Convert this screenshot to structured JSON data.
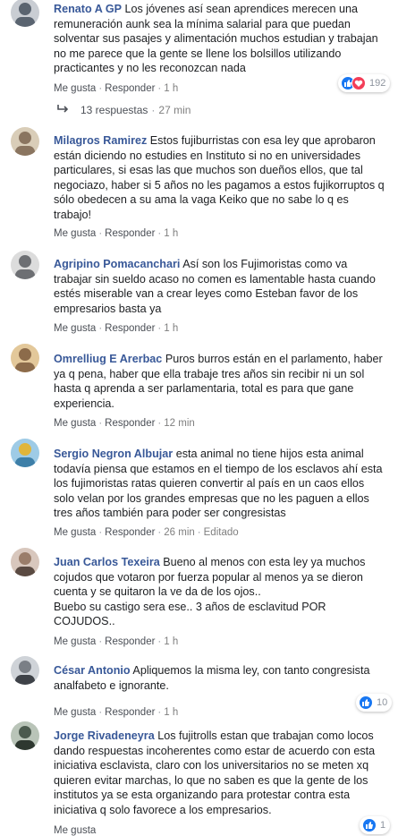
{
  "labels": {
    "like": "Me gusta",
    "reply": "Responder",
    "sep": "·"
  },
  "comments": [
    {
      "author": "Renato A GP",
      "text": "Los jóvenes así sean aprendices merecen una remuneración aunk sea la mínima salarial para que puedan solventar sus pasajes y alimentación muchos estudian y trabajan no me parece que la gente se llene los bolsillos utilizando practicantes y no les reconozcan nada",
      "time": "1 h",
      "reactions": "192",
      "avatar_color": "#5a6470"
    },
    {
      "author": "Milagros Ramirez",
      "text": "Estos fujiburristas con esa ley que aprobaron están diciendo no estudies en Instituto si no en universidades particulares, si esas las que muchos son dueños ellos, que tal negociazo, haber si 5 años no les pagamos a estos fujikorruptos q sólo obedecen a su ama la vaga Keiko que no sabe lo q es trabajo!",
      "time": "1 h",
      "avatar_color": "#8a7560"
    },
    {
      "author": "Agripino Pomacanchari",
      "text": "Así son los Fujimoristas como va trabajar sin sueldo acaso no comen es lamentable hasta cuando estés miserable van a crear leyes como Esteban favor de los empresarios basta ya",
      "time": "1 h",
      "avatar_color": "#6d6f73"
    },
    {
      "author": "Omrelliug E Arerbac",
      "text": "Puros burros están en el parlamento, haber ya q pena, haber que ella trabaje tres años sin recibir ni un sol hasta q aprenda a ser parlamentaria, total es para que gane experiencia.",
      "time": "12 min",
      "avatar_color": "#8c6b4a"
    },
    {
      "author": "Sergio Negron Albujar",
      "text": "esta animal no tiene hijos esta animal todavía piensa que estamos en el tiempo de los esclavos ahí esta los fujimoristas ratas quieren convertir al país en un caos ellos solo velan por los grandes empresas que no les paguen a ellos tres años también para poder ser congresistas",
      "time": "26 min",
      "edited": "Editado",
      "avatar_color": "#3d7fa8"
    },
    {
      "author": "Juan Carlos Texeira",
      "text": "Bueno al menos con esta ley ya muchos cojudos que votaron por fuerza popular al menos ya se dieron cuenta y se quitaron la ve da de los ojos..\nBuebo su castigo sera ese.. 3 años de esclavitud POR COJUDOS..",
      "time": "1 h",
      "avatar_color": "#9a7d6a"
    },
    {
      "author": "César Antonio",
      "text": "Apliquemos la misma ley, con tanto congresista analfabeto e ignorante.",
      "time": "1 h",
      "reactions": "10",
      "avatar_color": "#7a7f86"
    },
    {
      "author": "Jorge Rivadeneyra",
      "text": "Los fujitrolls estan que trabajan como locos dando respuestas incoherentes como estar de acuerdo con esta iniciativa esclavista, claro con los universitarios no se meten xq quieren evitar marchas, lo que no saben es que la gente de los institutos ya se esta organizando para protestar contra esta iniciativa q solo favorece a los empresarios.",
      "time": "",
      "reactions": "1",
      "avatar_color": "#4b5a4e"
    }
  ],
  "replies": {
    "count_label": "13 respuestas",
    "time": "27 min"
  }
}
